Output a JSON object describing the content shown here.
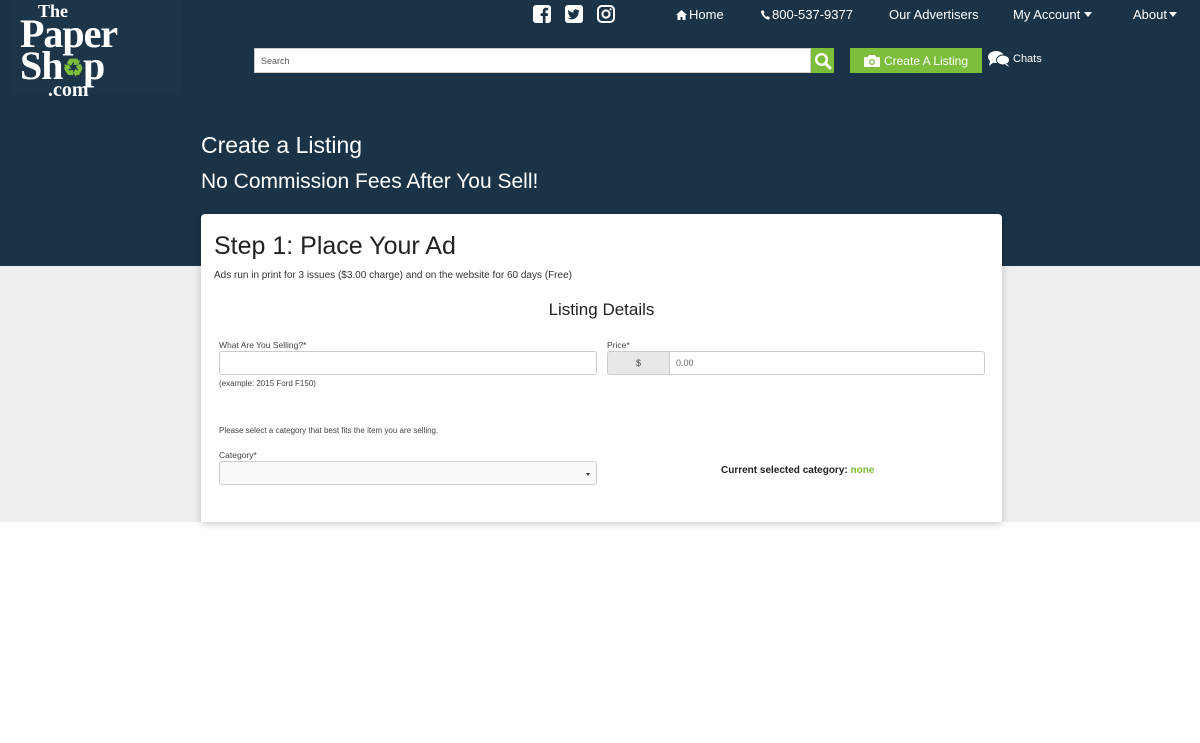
{
  "brand": {
    "logo_line1": "The",
    "logo_line2": "Paper",
    "logo_line3": "Sh",
    "logo_line3b": "p",
    "logo_line4": ".com",
    "accent_color": "#7cbd3c",
    "header_color": "#1a3347"
  },
  "social": [
    {
      "icon": "facebook-icon"
    },
    {
      "icon": "twitter-icon"
    },
    {
      "icon": "instagram-icon"
    }
  ],
  "nav": {
    "home": "Home",
    "phone": "800-537-9377",
    "advertisers": "Our Advertisers",
    "account": "My Account",
    "about": "About"
  },
  "search": {
    "placeholder": "Search"
  },
  "actions": {
    "create_listing": "Create A Listing",
    "chats": "Chats"
  },
  "hero": {
    "title": "Create a Listing",
    "subtitle": "No Commission Fees After You Sell!"
  },
  "form": {
    "step_title": "Step 1: Place Your Ad",
    "step_desc": "Ads run in print for 3 issues ($3.00 charge) and on the website for 60 days (Free)",
    "section_title": "Listing Details",
    "selling_label": "What Are You Selling?*",
    "selling_value": "",
    "selling_hint": "(example: 2015 Ford F150)",
    "price_label": "Price*",
    "price_prefix": "$",
    "price_placeholder": "0.00",
    "category_note": "Please select a category that best fits the item you are selling.",
    "category_label": "Category*",
    "category_value": "",
    "current_category_label": "Current selected category:",
    "current_category_value": "none"
  }
}
